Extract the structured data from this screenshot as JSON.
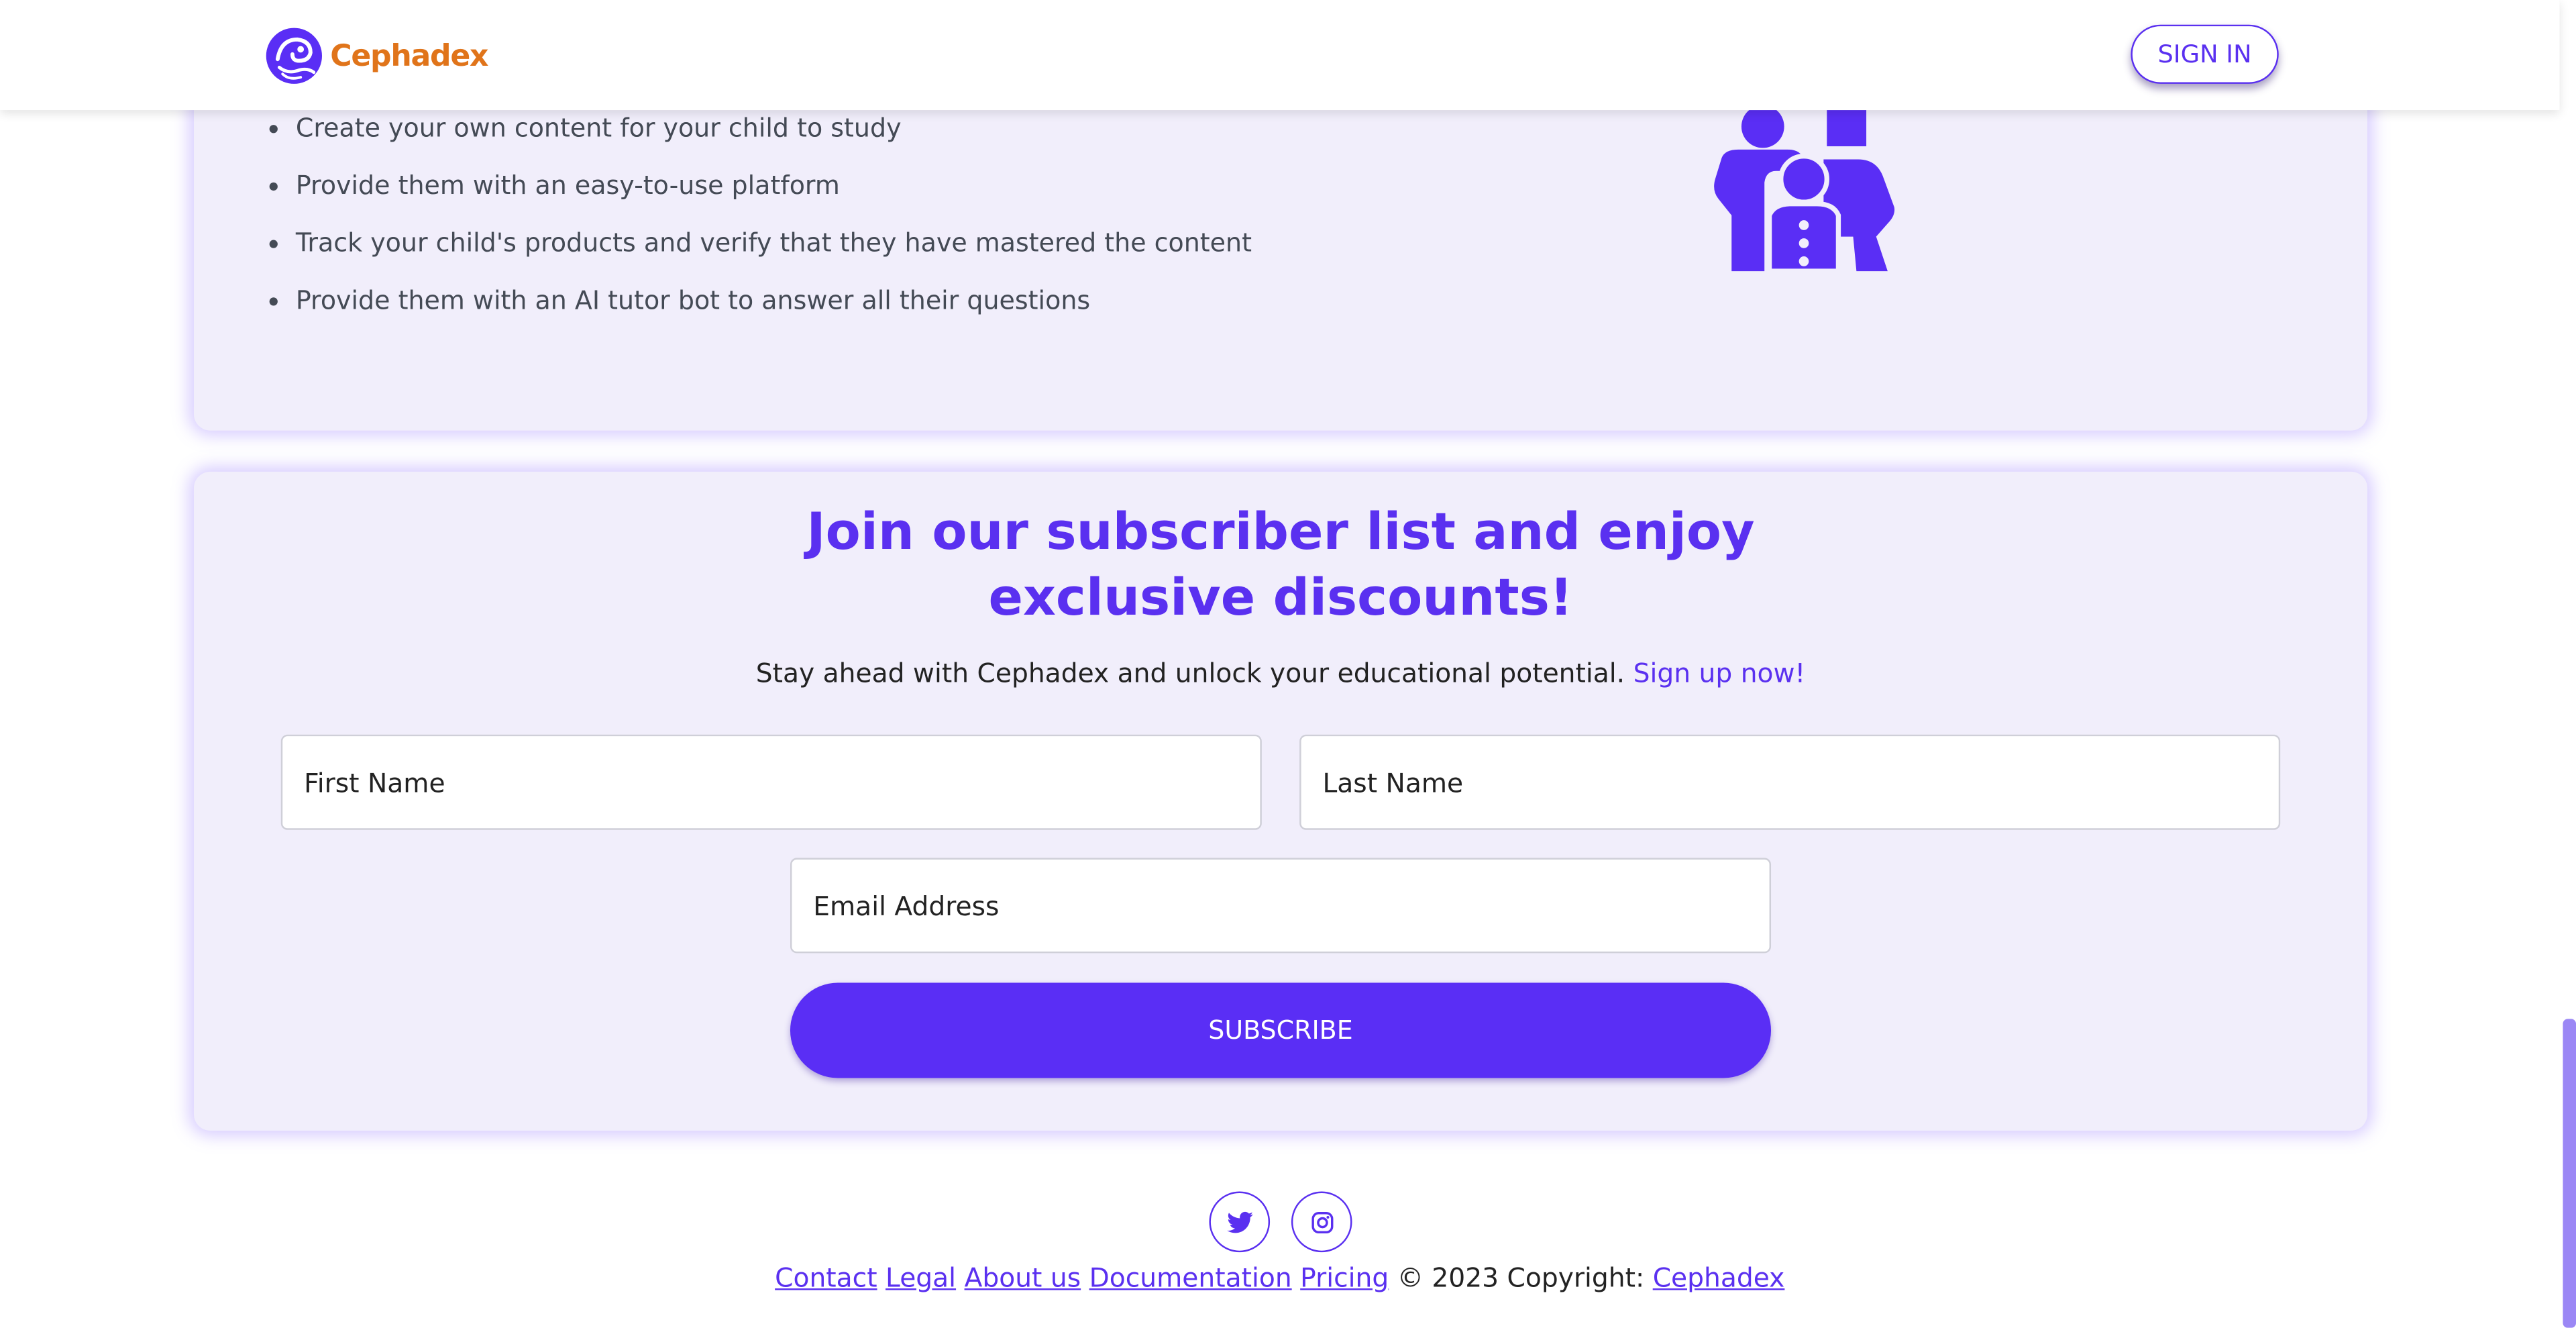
{
  "header": {
    "brand_name": "Cephadex",
    "signin_label": "SIGN IN"
  },
  "features": {
    "items": [
      "Create your own content for your child to study",
      "Provide them with an easy-to-use platform",
      "Track your child's products and verify that they have mastered the content",
      "Provide them with an AI tutor bot to answer all their questions"
    ],
    "illustration_icon": "family-icon"
  },
  "subscribe": {
    "title_line1": "Join our subscriber list and enjoy",
    "title_line2": "exclusive discounts!",
    "subtitle": "Stay ahead with Cephadex and unlock your educational potential.",
    "signup_link": "Sign up now!",
    "first_name_placeholder": "First Name",
    "last_name_placeholder": "Last Name",
    "email_placeholder": "Email Address",
    "button_label": "SUBSCRIBE"
  },
  "footer": {
    "social_icons": [
      "twitter-icon",
      "instagram-icon"
    ],
    "links": {
      "contact": "Contact",
      "legal": "Legal",
      "about": "About us",
      "documentation": "Documentation",
      "pricing": "Pricing"
    },
    "copyright_text": "© 2023 Copyright:",
    "copyright_link": "Cephadex"
  },
  "colors": {
    "accent": "#5a30f0",
    "brand_orange": "#e0741a",
    "card_background": "#f1eefb"
  }
}
